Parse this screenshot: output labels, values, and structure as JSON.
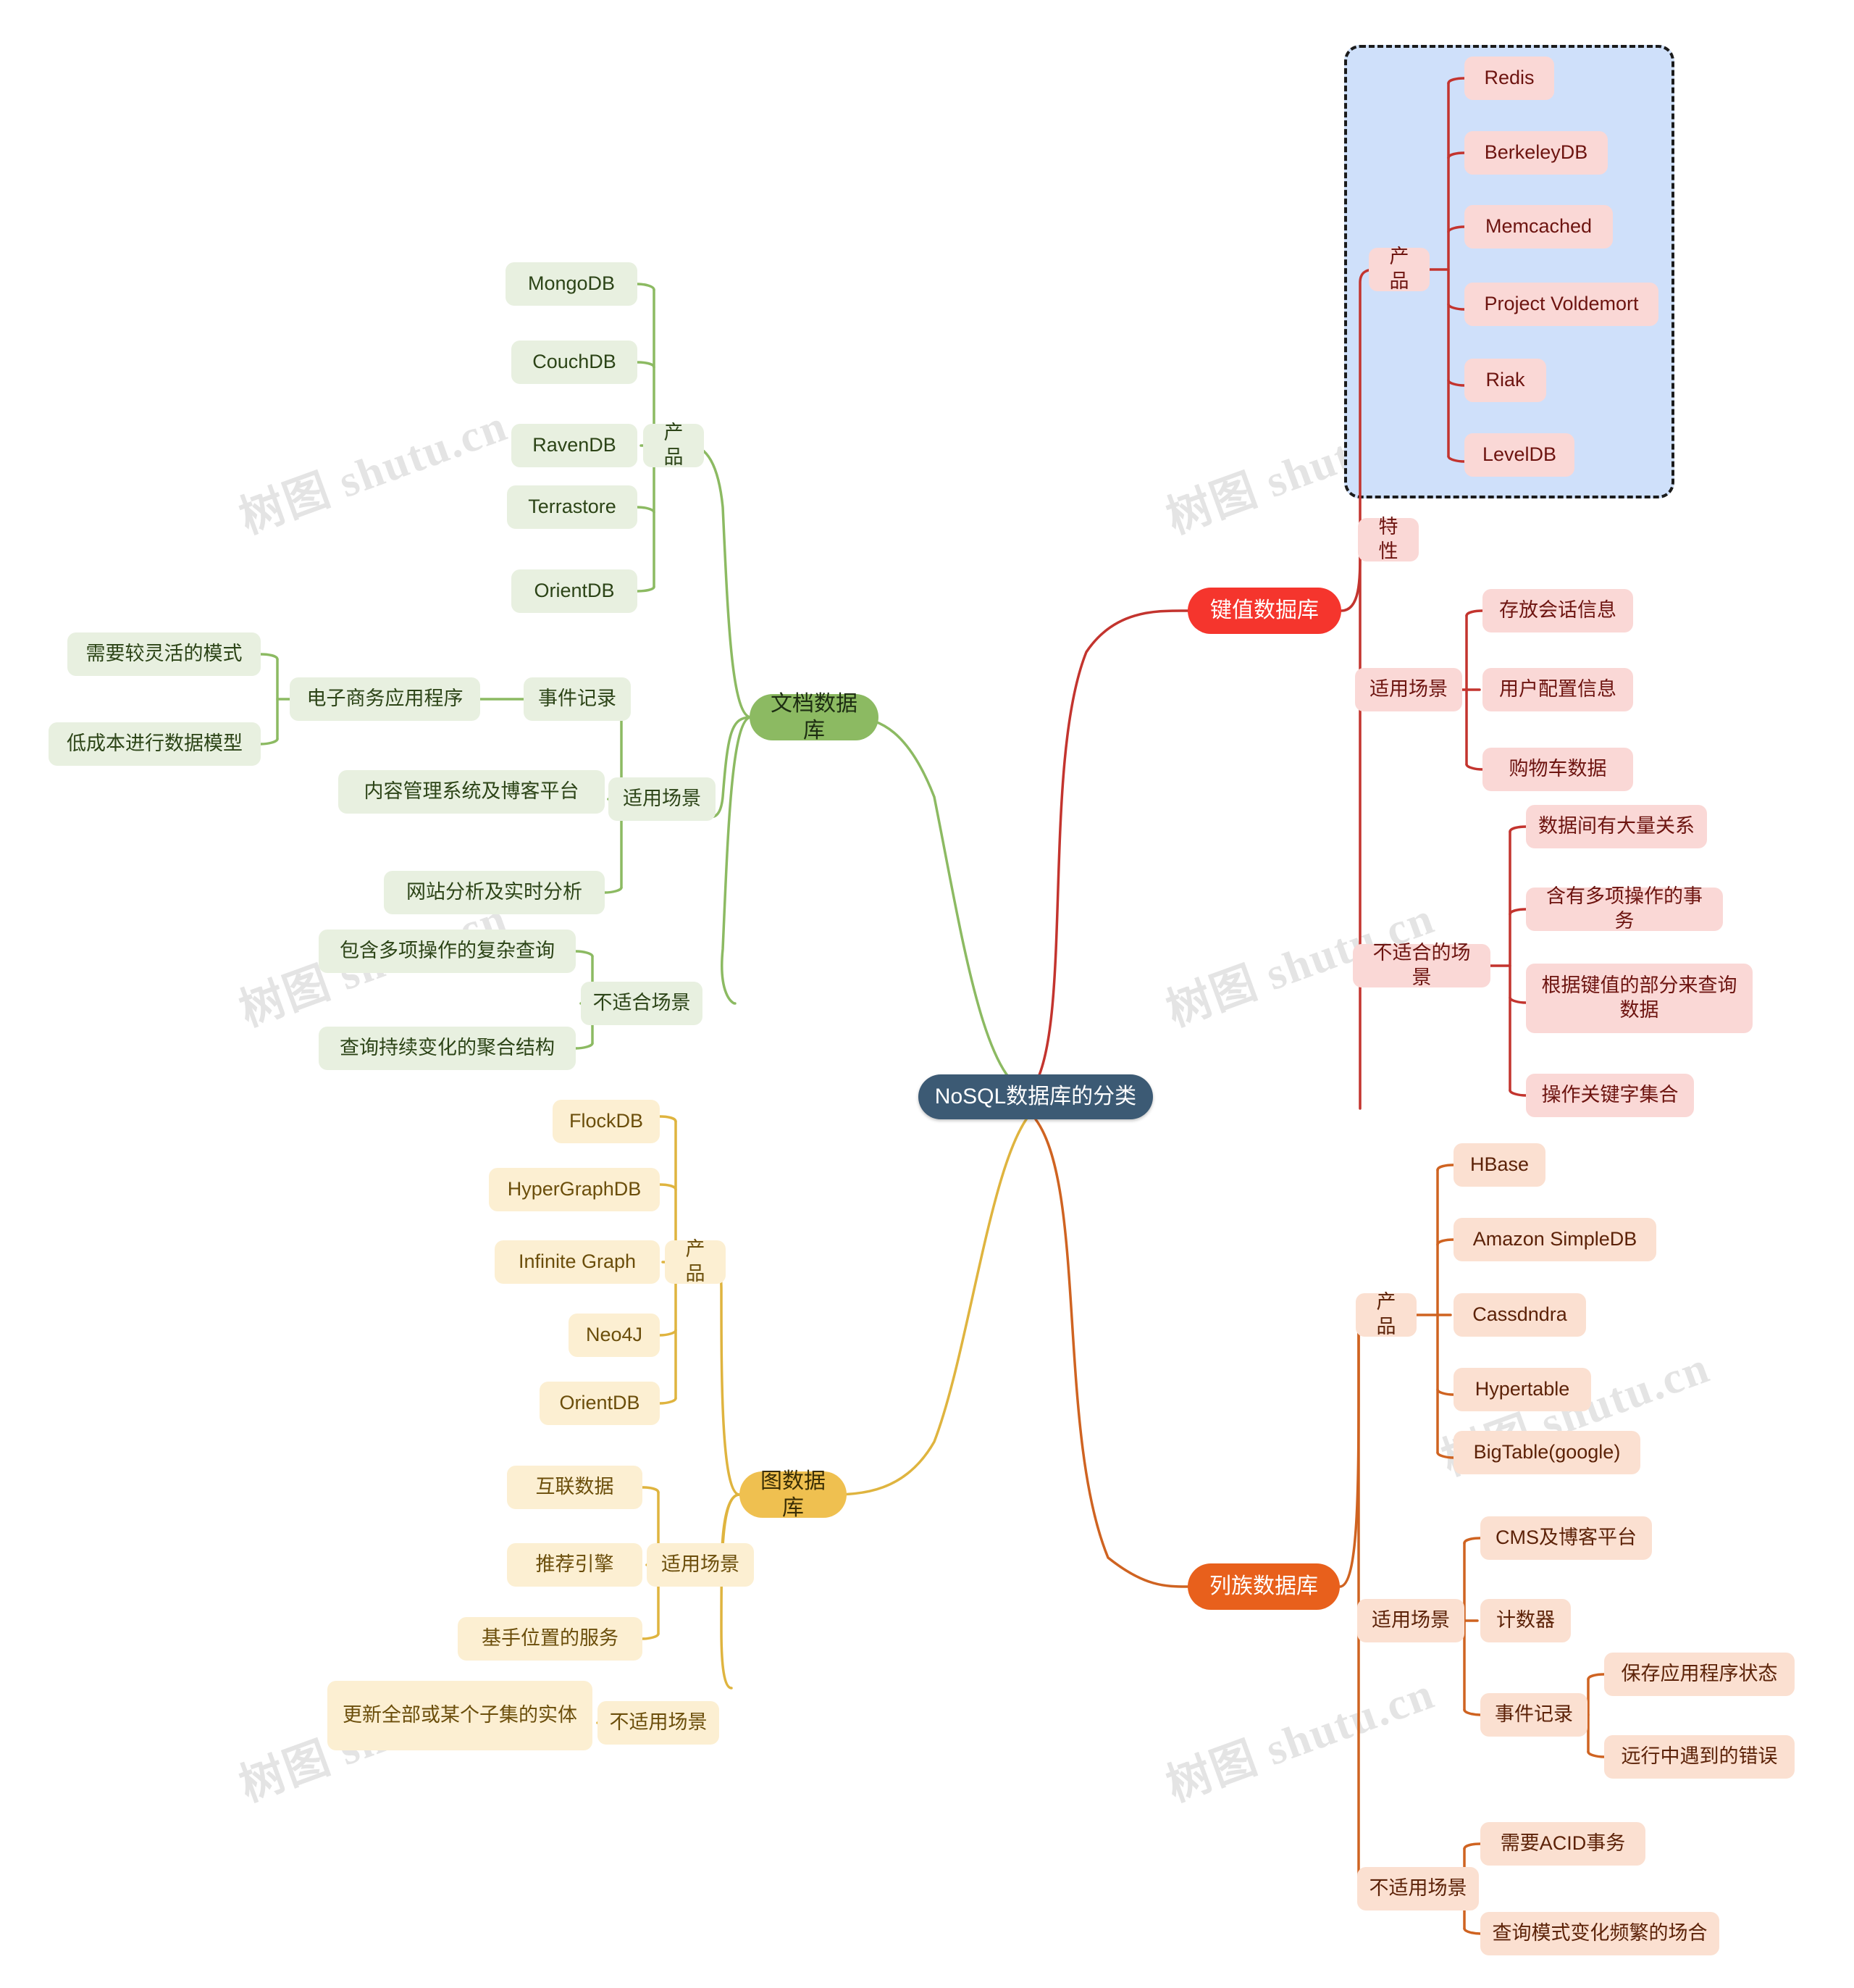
{
  "root": {
    "label": "NoSQL数据库的分类"
  },
  "watermark": {
    "text": "树图 shutu.cn"
  },
  "branches": {
    "document": {
      "label": "文档数据库",
      "color": "#8cba62",
      "product_label": "产品",
      "products": [
        "MongoDB",
        "CouchDB",
        "RavenDB",
        "Terrastore",
        "OrientDB"
      ],
      "fit_label": "适用场景",
      "fit_items": [
        "电子商务应用程序",
        "内容管理系统及博客平台",
        "网站分析及实时分析"
      ],
      "ecommerce_children": [
        "需要较灵活的模式",
        "低成本进行数据模型"
      ],
      "event_label": "事件记录",
      "unfit_label": "不适合场景",
      "unfit_items": [
        "包含多项操作的复杂查询",
        "查询持续变化的聚合结构"
      ]
    },
    "keyvalue": {
      "label": "键值数掘库",
      "color": "#f5352d",
      "product_label": "产品",
      "products": [
        "Redis",
        "BerkeleyDB",
        "Memcached",
        "Project Voldemort",
        "Riak",
        "LevelDB"
      ],
      "feature_label": "特性",
      "fit_label": "适用场景",
      "fit_items": [
        "存放会话信息",
        "用户配置信息",
        "购物车数据"
      ],
      "unfit_label": "不适合的场景",
      "unfit_items": [
        "数据间有大量关系",
        "含有多项操作的事务",
        "根据键值的部分来查询数据",
        "操作关键字集合"
      ]
    },
    "graph": {
      "label": "图数据库",
      "color": "#efc050",
      "product_label": "产品",
      "products": [
        "FlockDB",
        "HyperGraphDB",
        "Infinite Graph",
        "Neo4J",
        "OrientDB"
      ],
      "fit_label": "适用场景",
      "fit_items": [
        "互联数据",
        "推荐引擎",
        "基手位置的服务"
      ],
      "unfit_label": "不适用场景",
      "unfit_items": [
        "更新全部或某个子集的实体"
      ]
    },
    "column": {
      "label": "列族数据库",
      "color": "#e8601c",
      "product_label": "产品",
      "products": [
        "HBase",
        "Amazon SimpleDB",
        "Cassdndra",
        "Hypertable",
        "BigTable(google)"
      ],
      "fit_label": "适用场景",
      "fit_items": [
        "CMS及博客平台",
        "计数器",
        "事件记录"
      ],
      "event_children": [
        "保存应用程序状态",
        "远行中遇到的错误"
      ],
      "unfit_label": "不适用场景",
      "unfit_items": [
        "需要ACID事务",
        "查询模式变化频繁的场合"
      ]
    }
  }
}
